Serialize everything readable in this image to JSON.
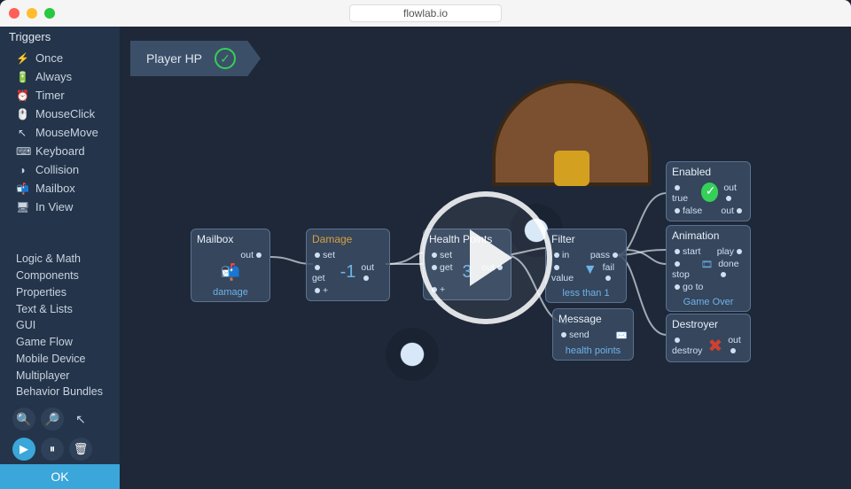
{
  "titlebar": {
    "url": "flowlab.io"
  },
  "sidebar": {
    "triggers_header": "Triggers",
    "triggers": [
      {
        "icon": "⚡",
        "label": "Once"
      },
      {
        "icon": "🔋",
        "label": "Always"
      },
      {
        "icon": "⏰",
        "label": "Timer"
      },
      {
        "icon": "🖱️",
        "label": "MouseClick"
      },
      {
        "icon": "↖",
        "label": "MouseMove"
      },
      {
        "icon": "⌨",
        "label": "Keyboard"
      },
      {
        "icon": "◑",
        "label": "Collision"
      },
      {
        "icon": "📬",
        "label": "Mailbox"
      },
      {
        "icon": "🖥",
        "label": "In View"
      }
    ],
    "categories": [
      "Logic & Math",
      "Components",
      "Properties",
      "Text & Lists",
      "GUI",
      "Game Flow",
      "Mobile Device",
      "Multiplayer",
      "Behavior Bundles"
    ],
    "ok_label": "OK"
  },
  "bundle_tab": "Player HP",
  "nodes": {
    "mailbox": {
      "title": "Mailbox",
      "out": "out",
      "sub": "damage"
    },
    "damage": {
      "title": "Damage",
      "ports": [
        "set",
        "get",
        "+"
      ],
      "value": "-1",
      "out": "out"
    },
    "hp": {
      "title": "Health Points",
      "ports": [
        "set",
        "get",
        "+"
      ],
      "value": "3",
      "out": "out"
    },
    "filter": {
      "title": "Filter",
      "in": "in",
      "value": "value",
      "pass": "pass",
      "fail": "fail",
      "sub": "less than 1"
    },
    "enabled": {
      "title": "Enabled",
      "true": "true",
      "false": "false",
      "out": "out"
    },
    "animation": {
      "title": "Animation",
      "start": "start",
      "stop": "stop",
      "goto": "go to",
      "play": "play",
      "done": "done",
      "sub": "Game Over"
    },
    "message": {
      "title": "Message",
      "send": "send",
      "sub": "health points"
    },
    "destroyer": {
      "title": "Destroyer",
      "destroy": "destroy",
      "out": "out"
    }
  }
}
